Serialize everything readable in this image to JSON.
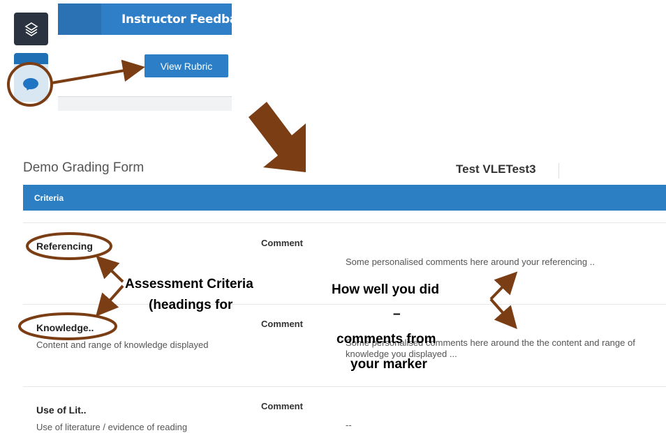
{
  "toolbar": {
    "layers_icon": "layers-icon",
    "feedback_icon": "speech-bubble-icon"
  },
  "panel": {
    "title": "Instructor Feedba",
    "view_rubric_label": "View Rubric"
  },
  "form": {
    "title": "Demo Grading Form",
    "student": "Test VLETest3",
    "criteria_header": "Criteria",
    "rows": [
      {
        "name": "Referencing",
        "description": "",
        "comment_label": "Comment",
        "comment": "Some personalised comments here around your referencing .."
      },
      {
        "name": "Knowledge..",
        "description": "Content and range of knowledge displayed",
        "comment_label": "Comment",
        "comment": "Some personalised comments here around the the content and range of knowledge you displayed ..."
      },
      {
        "name": "Use of Lit..",
        "description": "Use of literature / evidence of reading",
        "comment_label": "Comment",
        "comment": "--"
      }
    ]
  },
  "annotations": {
    "criteria_line1": "Assessment Criteria",
    "criteria_line2": "(headings for",
    "how_line1": "How well you did",
    "how_line2": "–",
    "how_line3": "comments from",
    "how_line4": "your marker"
  },
  "colors": {
    "annotation_brown": "#7b3e14",
    "brand_blue": "#2d7fc4"
  }
}
